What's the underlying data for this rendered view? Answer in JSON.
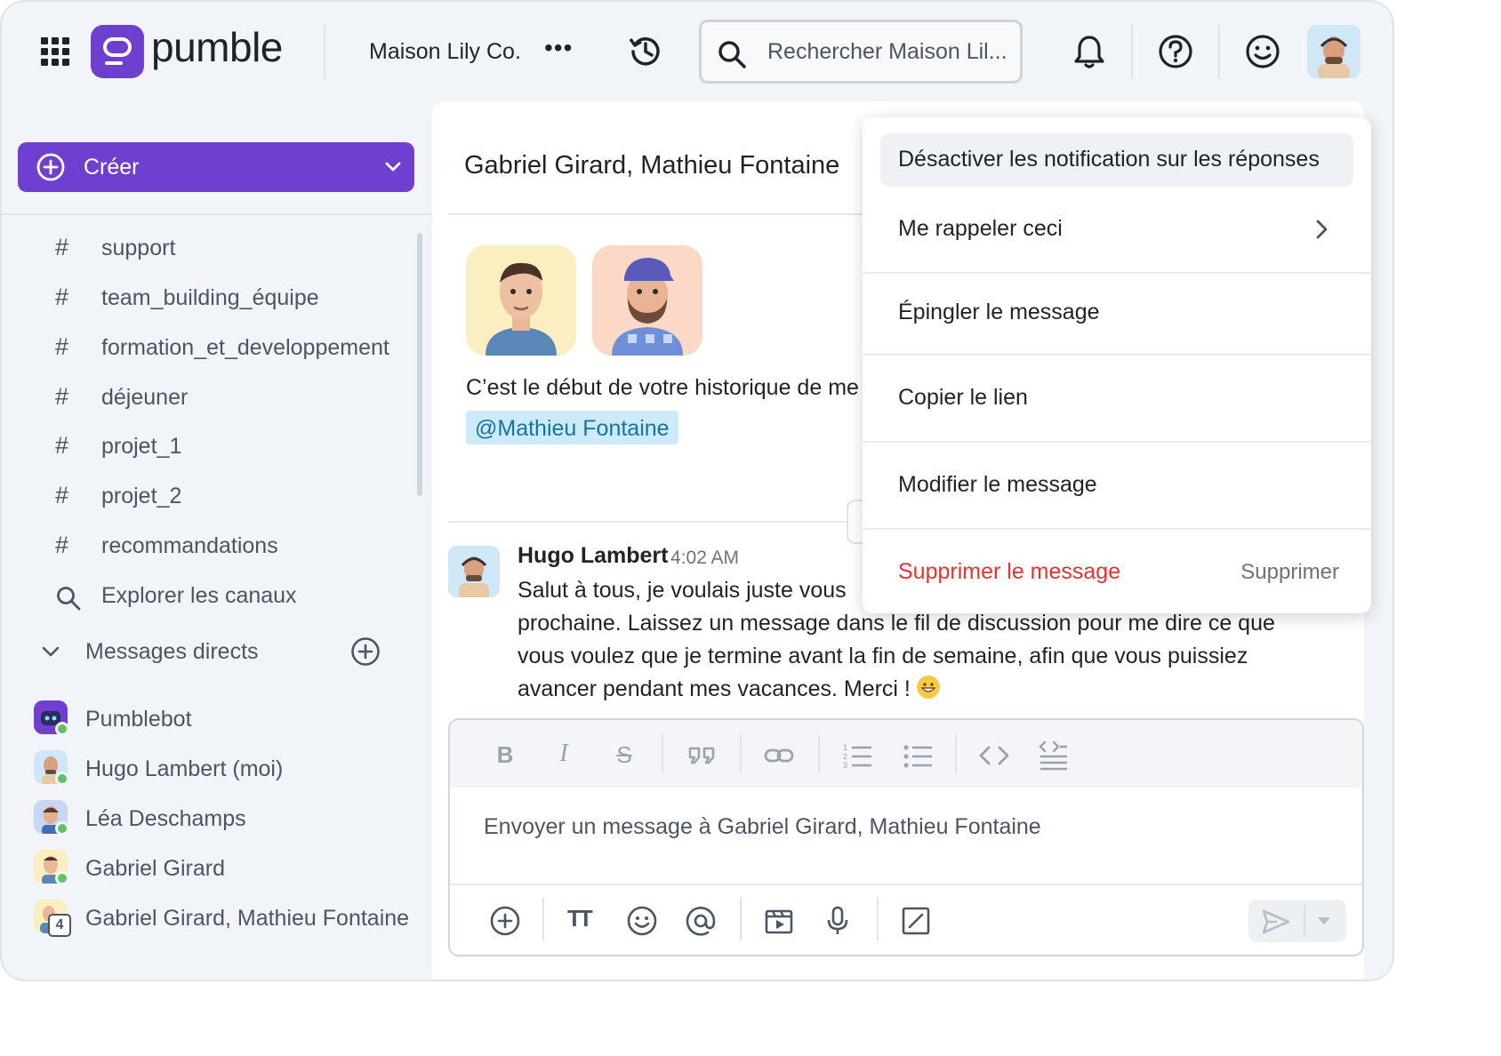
{
  "app": {
    "brand": "pumble",
    "workspace": "Maison Lily Co.",
    "workspace_more": "•••",
    "search_placeholder": "Rechercher Maison Lil..."
  },
  "colors": {
    "brand_purple": "#6f3fd0",
    "danger_red": "#e8322d",
    "mention_bg": "#cdeaf8",
    "mention_text": "#16749b",
    "online_green": "#63c163"
  },
  "icons": [
    "apps-grid-icon",
    "history-icon",
    "search-icon",
    "bell-icon",
    "help-icon",
    "smile-icon",
    "plus-circle-icon",
    "chevron-down-icon",
    "hash-icon",
    "chevron-right-icon",
    "send-icon"
  ],
  "sidebar": {
    "create_label": "Créer",
    "channels": [
      {
        "hash": "#",
        "name": "support"
      },
      {
        "hash": "#",
        "name": "team_building_équipe"
      },
      {
        "hash": "#",
        "name": "formation_et_developpement"
      },
      {
        "hash": "#",
        "name": "déjeuner"
      },
      {
        "hash": "#",
        "name": "projet_1"
      },
      {
        "hash": "#",
        "name": "projet_2"
      },
      {
        "hash": "#",
        "name": "recommandations"
      }
    ],
    "explore_label": "Explorer les canaux",
    "dm_header": "Messages directs",
    "direct_messages": [
      {
        "name": "Pumblebot"
      },
      {
        "name": "Hugo Lambert (moi)"
      },
      {
        "name": "Léa Deschamps"
      },
      {
        "name": "Gabriel Girard"
      },
      {
        "name": "Gabriel Girard, Mathieu Fontaine",
        "badge": "4"
      }
    ]
  },
  "conversation": {
    "title": "Gabriel Girard, Mathieu Fontaine",
    "intro": "C’est le début de votre historique de me",
    "mention": "@Mathieu Fontaine",
    "message": {
      "author": "Hugo Lambert",
      "time": "4:02 AM",
      "line1": "Salut à tous, je voulais juste vous",
      "line2": "prochaine. Laissez un message dans le fil de discussion pour me dire ce que",
      "line3": "vous voulez que je termine avant la fin de semaine, afin que vous puissiez",
      "line4": "avancer pendant mes vacances. Merci !"
    }
  },
  "composer": {
    "placeholder": "Envoyer un message à Gabriel Girard, Mathieu Fontaine",
    "format_buttons": [
      "B",
      "I",
      "S",
      "quote",
      "link",
      "ordered-list",
      "bullet-list",
      "code",
      "code-block"
    ],
    "bold": "B",
    "italic": "I",
    "strike": "S",
    "text_size": "TT"
  },
  "context_menu": {
    "items": [
      {
        "label": "Désactiver les notification sur les réponses"
      },
      {
        "label": "Me rappeler ceci"
      },
      {
        "label": "Épingler le message"
      },
      {
        "label": "Copier le lien"
      },
      {
        "label": "Modifier le message"
      },
      {
        "label": "Supprimer le message",
        "shortcut": "Supprimer"
      }
    ]
  }
}
